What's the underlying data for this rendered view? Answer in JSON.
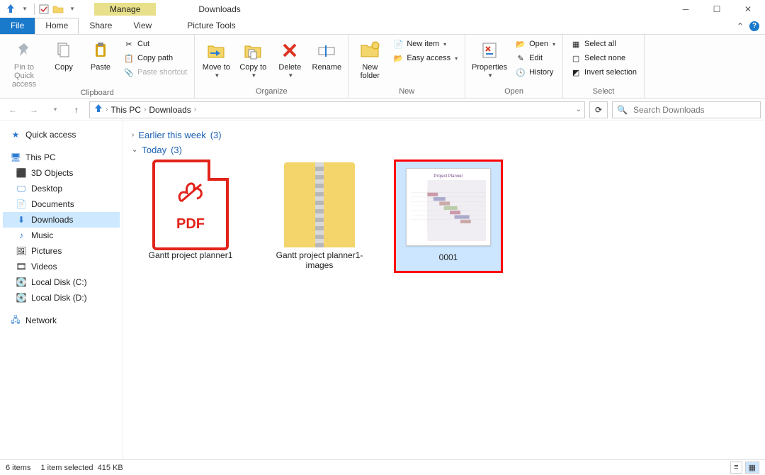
{
  "title": "Downloads",
  "context_tab": "Manage",
  "context_sub": "Picture Tools",
  "tabs": {
    "file": "File",
    "home": "Home",
    "share": "Share",
    "view": "View"
  },
  "ribbon": {
    "clipboard": {
      "label": "Clipboard",
      "pin": "Pin to Quick access",
      "copy": "Copy",
      "paste": "Paste",
      "cut": "Cut",
      "copy_path": "Copy path",
      "paste_shortcut": "Paste shortcut"
    },
    "organize": {
      "label": "Organize",
      "move": "Move to",
      "copy": "Copy to",
      "delete": "Delete",
      "rename": "Rename"
    },
    "new": {
      "label": "New",
      "new_folder": "New folder",
      "new_item": "New item",
      "easy_access": "Easy access"
    },
    "open": {
      "label": "Open",
      "properties": "Properties",
      "open": "Open",
      "edit": "Edit",
      "history": "History"
    },
    "select": {
      "label": "Select",
      "select_all": "Select all",
      "select_none": "Select none",
      "invert": "Invert selection"
    }
  },
  "breadcrumb": {
    "seg1": "This PC",
    "seg2": "Downloads"
  },
  "search_placeholder": "Search Downloads",
  "sidebar": {
    "quick": "Quick access",
    "thispc": "This PC",
    "items": [
      "3D Objects",
      "Desktop",
      "Documents",
      "Downloads",
      "Music",
      "Pictures",
      "Videos",
      "Local Disk (C:)",
      "Local Disk (D:)"
    ],
    "network": "Network"
  },
  "groups": {
    "earlier": {
      "label": "Earlier this week",
      "count": "(3)"
    },
    "today": {
      "label": "Today",
      "count": "(3)"
    }
  },
  "files": {
    "pdf_name": "Gantt project planner1",
    "pdf_label": "PDF",
    "zip_name": "Gantt project planner1-images",
    "img_name": "0001"
  },
  "status": {
    "count": "6 items",
    "selected": "1 item selected",
    "size": "415 KB"
  }
}
